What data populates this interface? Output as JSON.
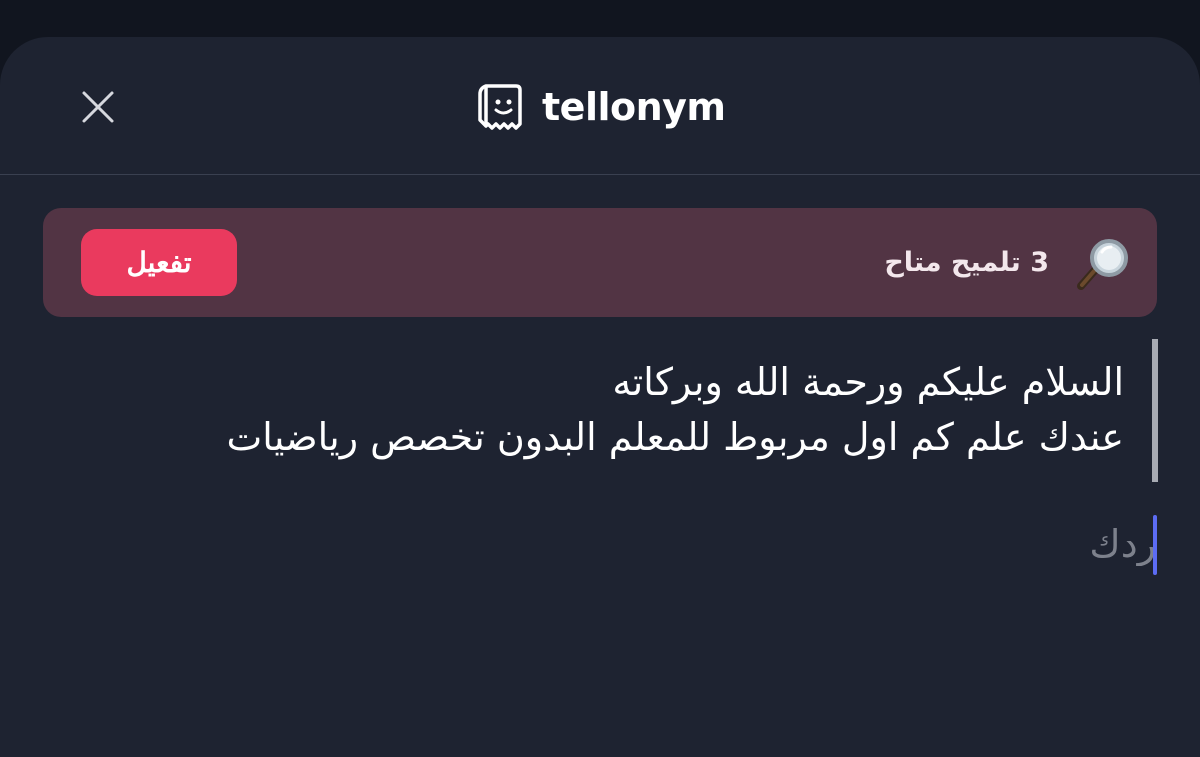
{
  "header": {
    "brand": "tellonym",
    "close_icon": "close-icon",
    "logo_icon": "tellonym-logo-icon"
  },
  "hint_banner": {
    "text": "3 تلميح متاح",
    "button_label": "تفعيل",
    "icon": "magnifying-glass-icon",
    "background_color": "#523444",
    "button_color": "#ea3a5e"
  },
  "question": {
    "text": "السلام عليكم ورحمة الله وبركاته\nعندك علم كم اول مربوط للمعلم البدون تخصص رياضيات"
  },
  "reply": {
    "placeholder": "ردك",
    "value": ""
  },
  "colors": {
    "background": "#1e2331",
    "accent": "#5c6cf4"
  }
}
